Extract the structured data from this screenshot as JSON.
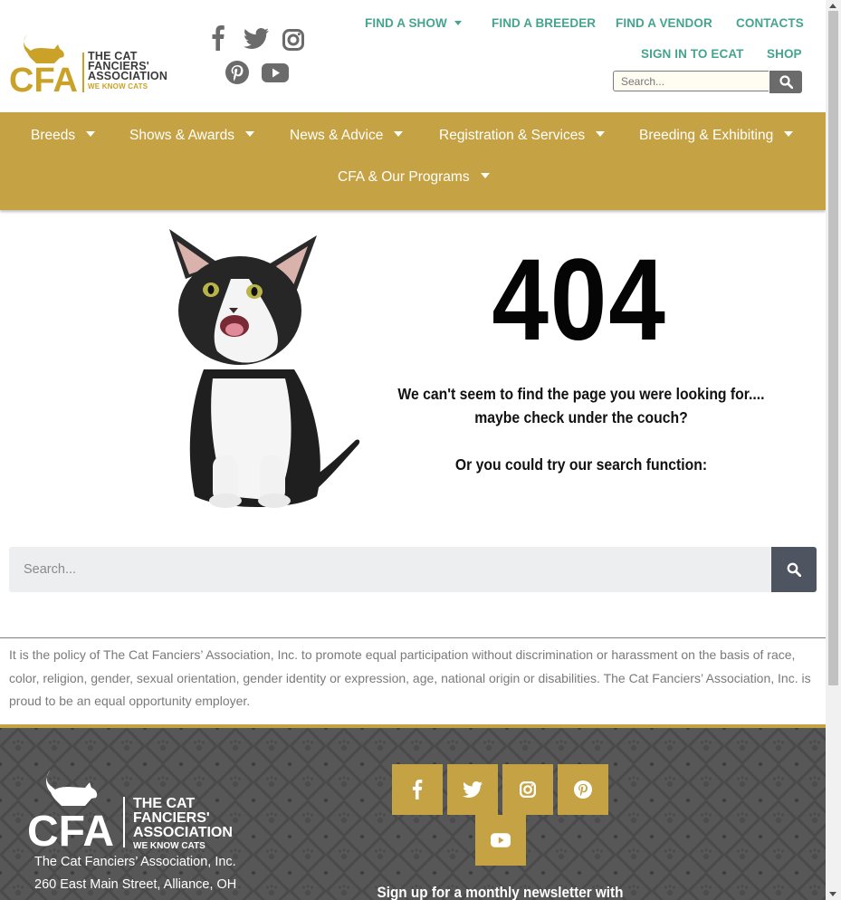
{
  "header": {
    "logo": {
      "letters": "CFA",
      "name_line1": "THE CAT",
      "name_line2": "FANCIERS'",
      "name_line3": "ASSOCIATION",
      "tagline": "WE KNOW CATS"
    },
    "social_icons": [
      "facebook-icon",
      "twitter-icon",
      "instagram-icon",
      "pinterest-icon",
      "youtube-icon"
    ],
    "top_links": {
      "find_show": "FIND A SHOW",
      "find_breeder": "FIND A BREEDER",
      "find_vendor": "FIND A VENDOR",
      "contacts": "CONTACTS",
      "sign_in": "SIGN IN TO ECAT",
      "shop": "SHOP"
    },
    "search_placeholder": "Search..."
  },
  "nav": {
    "items": [
      "Breeds",
      "Shows & Awards",
      "News & Advice",
      "Registration & Services",
      "Breeding & Exhibiting",
      "CFA & Our Programs"
    ]
  },
  "error": {
    "code": "404",
    "line1": "We can't seem to find the page you were looking for....",
    "line2": "maybe check under the couch?",
    "line3": "Or you could try our search function:"
  },
  "main_search": {
    "placeholder": "Search..."
  },
  "policy_text": "It is the policy of The Cat Fanciers’ Association, Inc. to promote equal participation without discrimination or harassment on the basis of race, color, religion, gender, sexual orientation, gender identity or expression, age, national origin or disabilities. The Cat Fanciers’ Association, Inc. is proud to be an equal opportunity employer.",
  "footer": {
    "logo": {
      "letters": "CFA",
      "name_line1": "THE CAT",
      "name_line2": "FANCIERS'",
      "name_line3": "ASSOCIATION",
      "tagline": "WE KNOW CATS"
    },
    "org_name": "The Cat Fanciers’ Association, Inc.",
    "address": "260 East Main Street, Alliance, OH",
    "social_icons": [
      "facebook-icon",
      "twitter-icon",
      "instagram-icon",
      "pinterest-icon",
      "youtube-icon"
    ],
    "newsletter": "Sign up for a monthly newsletter with"
  },
  "colors": {
    "gold": "#c5a243",
    "teal": "#45a48f",
    "footer_bg": "#575757",
    "search_button": "#4e5560"
  }
}
